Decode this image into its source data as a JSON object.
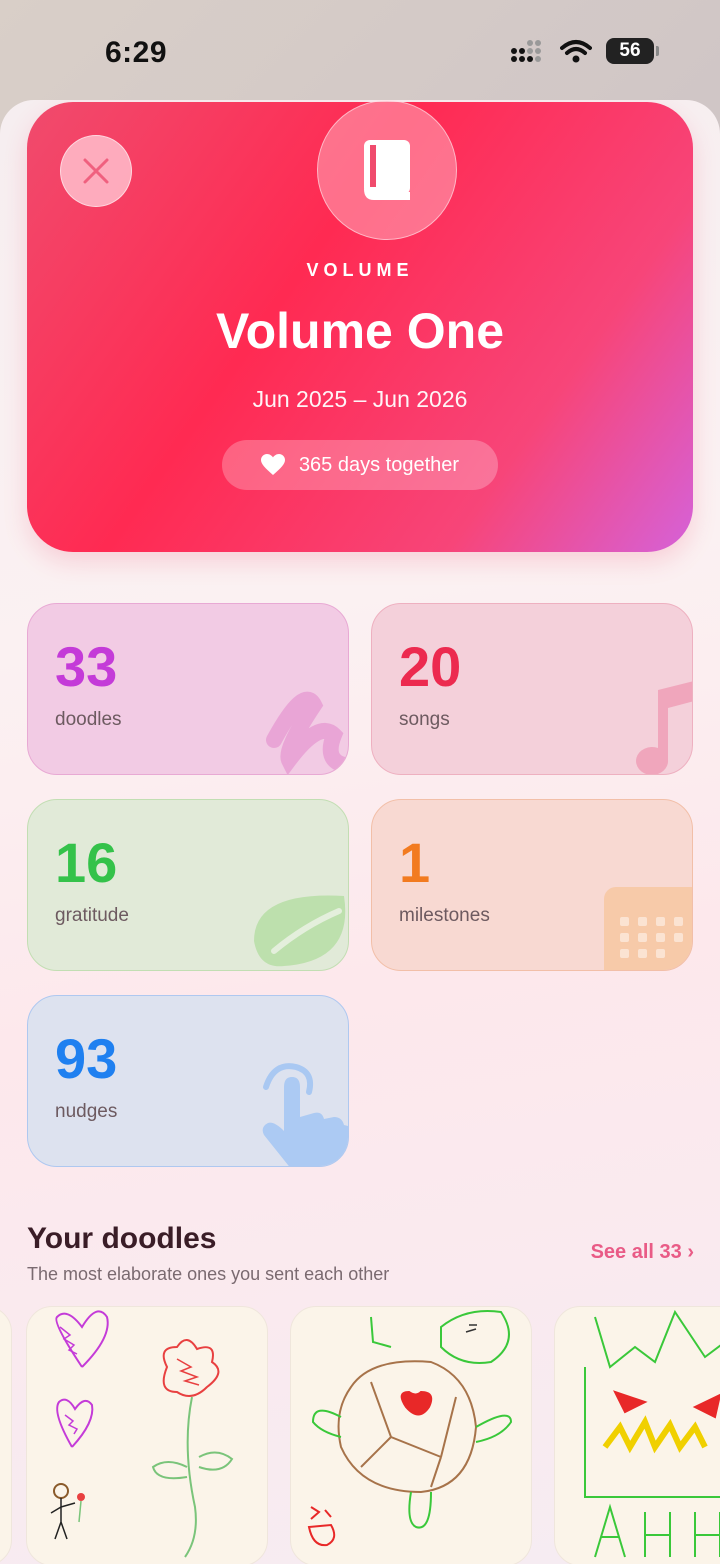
{
  "status_bar": {
    "time": "6:29",
    "battery": "56"
  },
  "hero": {
    "label": "VOLUME",
    "title": "Volume One",
    "dates": "Jun 2025 – Jun 2026",
    "pill": "365 days together",
    "icons": {
      "close": "close-icon",
      "book": "book-icon",
      "heart": "heart-icon"
    }
  },
  "stats": [
    {
      "value": "33",
      "label": "doodles",
      "color": "#c43bd8",
      "icon": "scribble-icon"
    },
    {
      "value": "20",
      "label": "songs",
      "color": "#ec2a4f",
      "icon": "music-note-icon"
    },
    {
      "value": "16",
      "label": "gratitude",
      "color": "#34c24a",
      "icon": "leaf-icon"
    },
    {
      "value": "1",
      "label": "milestones",
      "color": "#f27b20",
      "icon": "calendar-icon"
    },
    {
      "value": "93",
      "label": "nudges",
      "color": "#1f80f0",
      "icon": "hand-tap-icon"
    }
  ],
  "doodles": {
    "title": "Your doodles",
    "subtitle": "The most elaborate ones you sent each other",
    "see_all": "See all 33 ›",
    "items": [
      "doodle-hearts-flower",
      "doodle-turtle",
      "doodle-monster"
    ]
  }
}
